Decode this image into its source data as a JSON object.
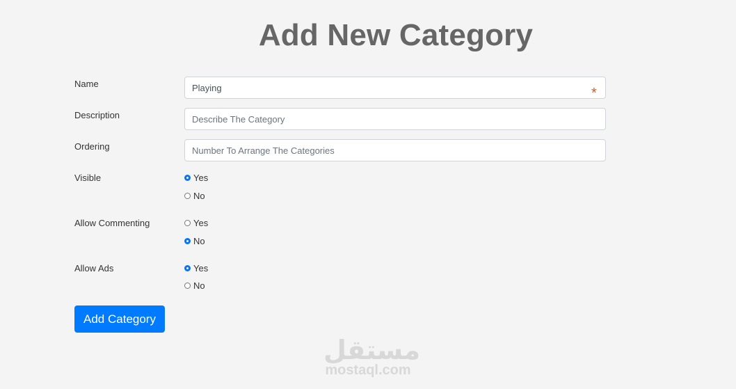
{
  "page": {
    "title": "Add New Category"
  },
  "form": {
    "name": {
      "label": "Name",
      "value": "Playing",
      "required_marker": "*"
    },
    "description": {
      "label": "Description",
      "placeholder": "Describe The Category"
    },
    "ordering": {
      "label": "Ordering",
      "placeholder": "Number To Arrange The Categories"
    },
    "visible": {
      "label": "Visible",
      "options": [
        {
          "label": "Yes",
          "checked": true
        },
        {
          "label": "No",
          "checked": false
        }
      ]
    },
    "allow_commenting": {
      "label": "Allow Commenting",
      "options": [
        {
          "label": "Yes",
          "checked": false
        },
        {
          "label": "No",
          "checked": true
        }
      ]
    },
    "allow_ads": {
      "label": "Allow Ads",
      "options": [
        {
          "label": "Yes",
          "checked": true
        },
        {
          "label": "No",
          "checked": false
        }
      ]
    },
    "submit_label": "Add Category"
  },
  "watermark": {
    "arabic": "مستقل",
    "latin": "mostaql.com"
  },
  "colors": {
    "primary": "#007bff",
    "radio_checked": "#0075ff",
    "title": "#666666",
    "background": "#f4f4f4",
    "asterisk": "#c0622a"
  }
}
